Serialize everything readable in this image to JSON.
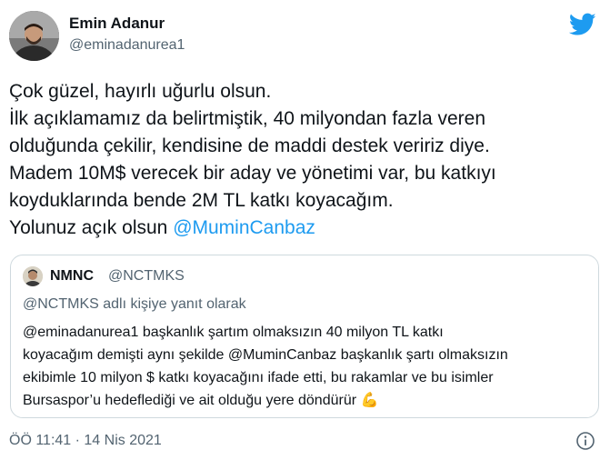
{
  "author": {
    "name": "Emin Adanur",
    "handle": "@eminadanurea1"
  },
  "tweet": {
    "lines": [
      "Çok güzel, hayırlı uğurlu olsun.",
      "İlk açıklamamız da belirtmiştik, 40 milyondan fazla veren",
      "olduğunda çekilir, kendisine de maddi destek veririz diye.",
      "Madem 10M$ verecek bir aday ve yönetimi var, bu katkıyı",
      "koyduklarında bende 2M TL katkı koyacağım."
    ],
    "last_line_text": "Yolunuz açık olsun ",
    "last_line_mention": "@MuminCanbaz"
  },
  "quote": {
    "name": "NMNC",
    "handle": "@NCTMKS",
    "reply_context": "@NCTMKS adlı kişiye yanıt olarak",
    "lines": [
      "@eminadanurea1 başkanlık şartım olmaksızın 40 milyon TL katkı",
      "koyacağım demişti aynı şekilde @MuminCanbaz başkanlık şartı olmaksızın",
      "ekibimle 10 milyon $ katkı koyacağını ifade etti, bu rakamlar ve bu isimler",
      "Bursaspor’u hedeflediği ve ait olduğu yere döndürür "
    ],
    "emoji": "💪"
  },
  "meta": {
    "timestamp": "ÖÖ 11:41 · 14 Nis 2021"
  },
  "icons": {
    "brand": "twitter-bird-icon",
    "info": "info-icon"
  },
  "colors": {
    "accent": "#1d9bf0",
    "secondary_text": "#536471",
    "border": "#cfd9de"
  }
}
